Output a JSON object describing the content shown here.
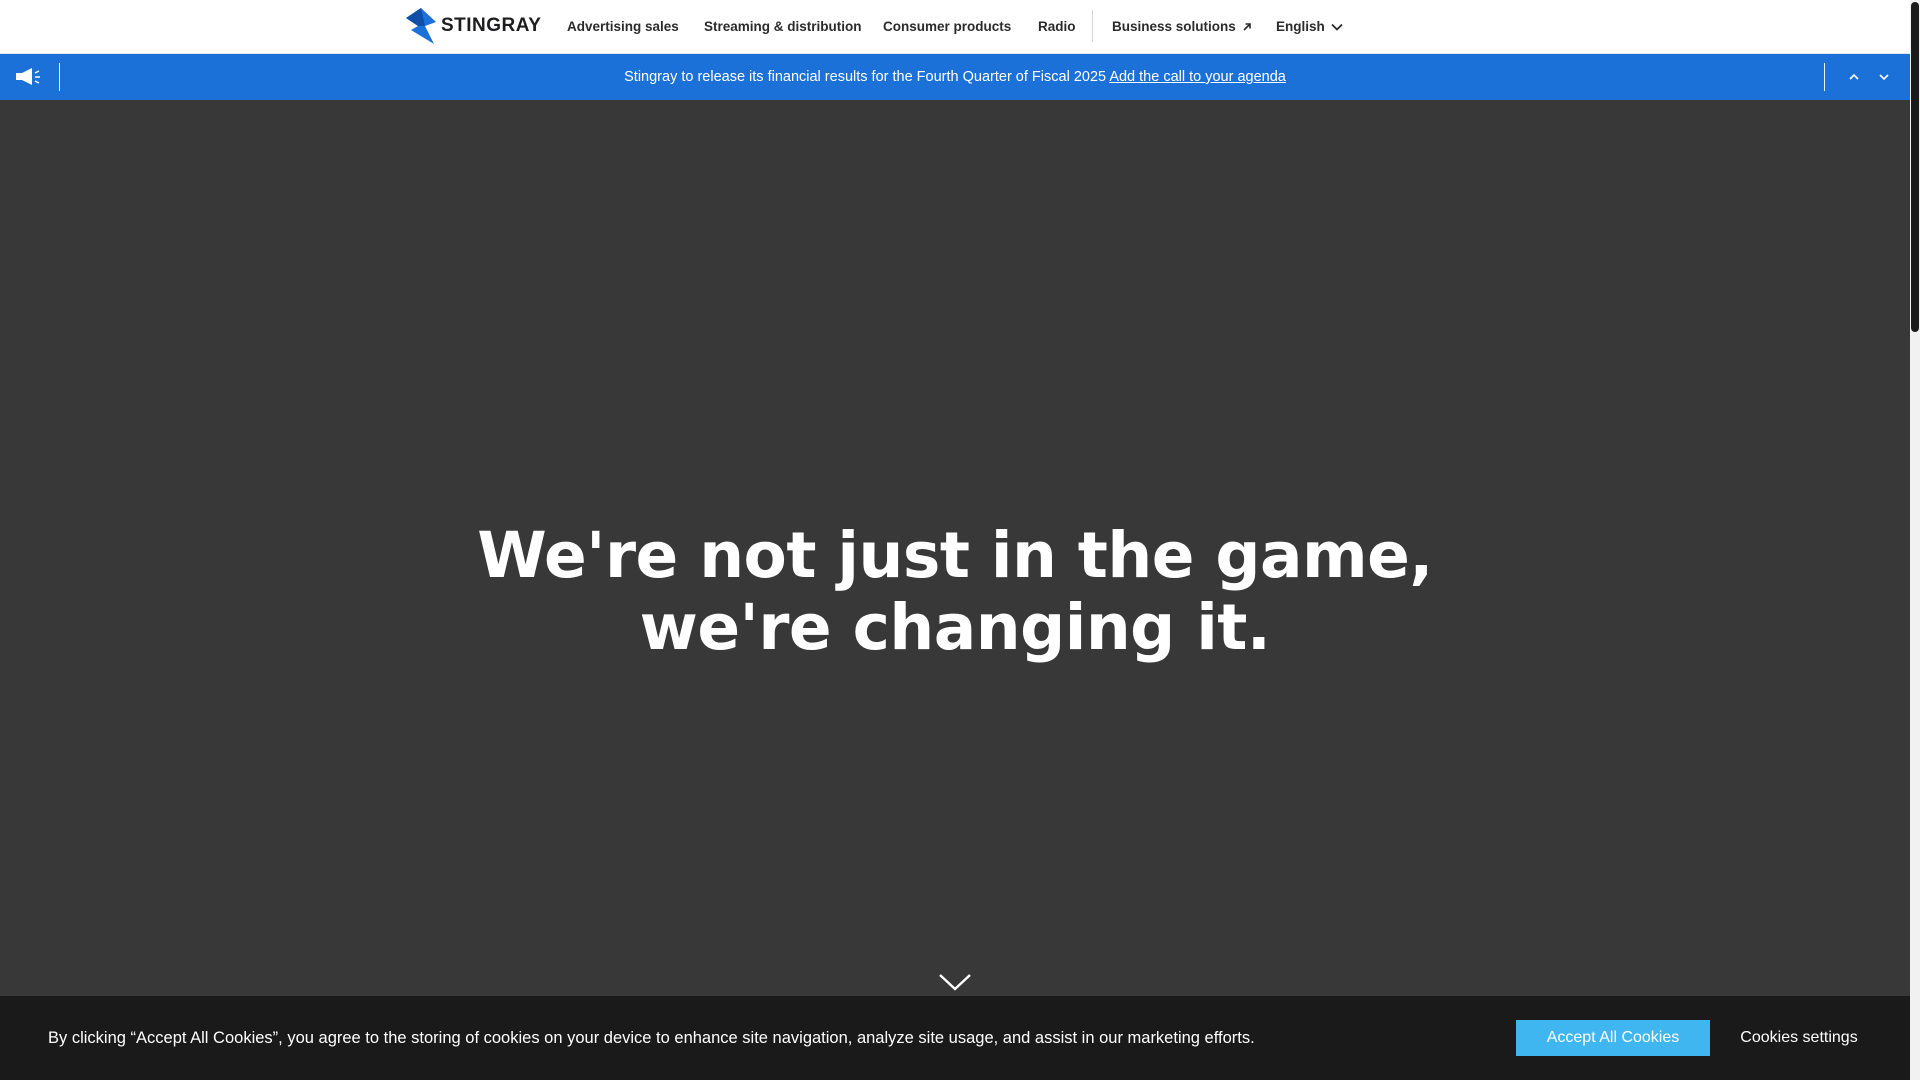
{
  "nav": {
    "logo_text": "STINGRAY",
    "logo_icon": "stingray-logo-icon",
    "items": [
      {
        "label": "Advertising sales"
      },
      {
        "label": "Streaming & distribution"
      },
      {
        "label": "Consumer products"
      },
      {
        "label": "Radio"
      }
    ],
    "business_solutions": {
      "label": "Business solutions",
      "icon": "external-arrow-icon"
    },
    "language": {
      "label": "English",
      "icon": "chevron-down-icon"
    }
  },
  "announcement": {
    "icon": "megaphone-icon",
    "text": "Stingray to release its financial results for the Fourth Quarter of Fiscal 2025",
    "link_text": "Add the call to your agenda",
    "prev_icon": "chevron-up-icon",
    "next_icon": "chevron-down-icon"
  },
  "hero": {
    "line1": "We're not just in the game,",
    "line2": "we're changing it.",
    "scroll_icon": "chevron-down-icon"
  },
  "cookie": {
    "text": "By clicking “Accept All Cookies”, you agree to the storing of cookies on your device to enhance site navigation, analyze site usage, and assist in our marketing efforts.",
    "accept_label": "Accept All Cookies",
    "settings_label": "Cookies settings"
  },
  "colors": {
    "nav_bg": "#ffffff",
    "announcement_bg": "#1c71d8",
    "hero_bg": "#383838",
    "cookie_bg": "#1a1a1a",
    "accept_button": "#3fb6f0",
    "brand_blue": "#1c71d8"
  }
}
